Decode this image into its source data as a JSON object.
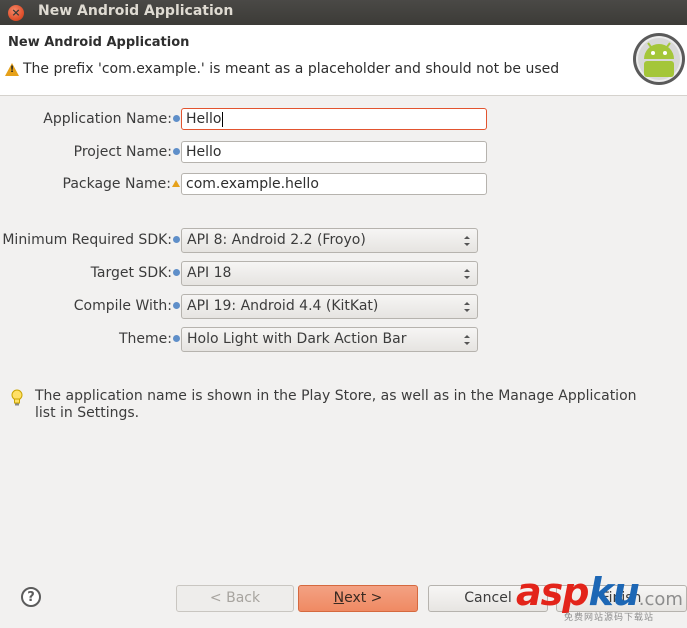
{
  "window": {
    "title": "New Android Application"
  },
  "banner": {
    "heading": "New Android Application",
    "warning": "The prefix 'com.example.' is meant as a placeholder and should not be used"
  },
  "form": {
    "application_name": {
      "label": "Application Name:",
      "value": "Hello"
    },
    "project_name": {
      "label": "Project Name:",
      "value": "Hello"
    },
    "package_name": {
      "label": "Package Name:",
      "value": "com.example.hello"
    },
    "min_sdk": {
      "label": "Minimum Required SDK:",
      "value": "API 8: Android 2.2 (Froyo)"
    },
    "target_sdk": {
      "label": "Target SDK:",
      "value": "API 18"
    },
    "compile_with": {
      "label": "Compile With:",
      "value": "API 19: Android 4.4 (KitKat)"
    },
    "theme": {
      "label": "Theme:",
      "value": "Holo Light with Dark Action Bar"
    }
  },
  "hint": "The application name is shown in the Play Store, as well as in the Manage Application list in Settings.",
  "buttons": {
    "back": "< Back",
    "next_mnemonic": "N",
    "next_rest": "ext >",
    "cancel": "Cancel",
    "finish": "Finish"
  },
  "watermark": {
    "brand_a": "asp",
    "brand_b": "ku",
    "brand_c": ".com",
    "tagline": "免费网站源码下载站"
  },
  "colors": {
    "accent": "#e2542f",
    "next_button": "#ef8a63",
    "title_bar": "#3c3b37",
    "info": "#5f8fc9",
    "warning": "#e6a11a",
    "android_green": "#a4c639"
  },
  "icons": [
    "close-icon",
    "warning-icon",
    "android-logo",
    "info-icon",
    "lightbulb-icon",
    "help-icon",
    "chevron-updown-icon"
  ]
}
